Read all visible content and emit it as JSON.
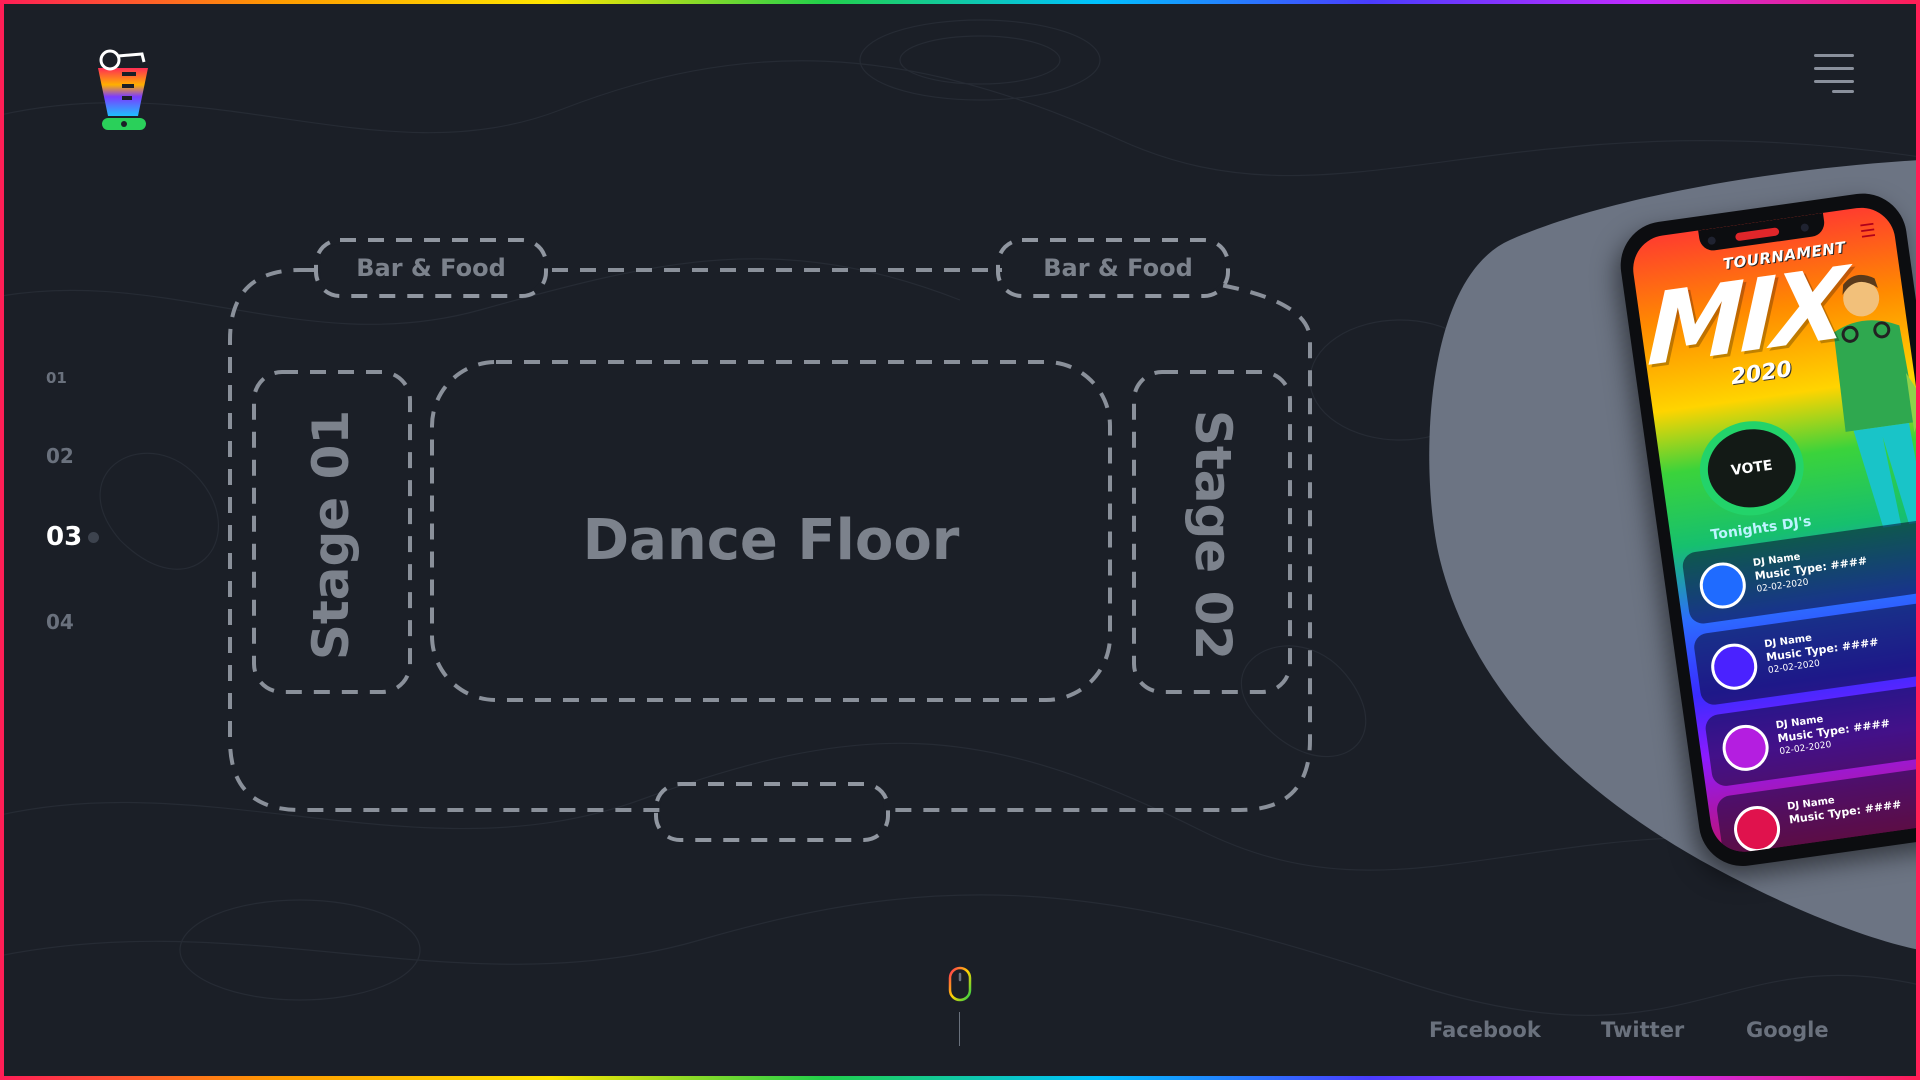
{
  "pager": {
    "items": [
      {
        "label": "01"
      },
      {
        "label": "02"
      },
      {
        "label": "03",
        "active": true
      },
      {
        "label": "04"
      }
    ]
  },
  "floorplan": {
    "bar_left": "Bar & Food",
    "bar_right": "Bar & Food",
    "stage_left": "Stage 01",
    "stage_right": "Stage 02",
    "center": "Dance Floor"
  },
  "phone": {
    "subtitle": "TOURNAMENT",
    "title": "MIX",
    "year": "2020",
    "vote_label": "VOTE",
    "list_heading": "Tonights DJ's",
    "djs": [
      {
        "name": "DJ Name",
        "type": "Music Type: ####",
        "date": "02-02-2020",
        "color": "#1f6bff"
      },
      {
        "name": "DJ Name",
        "type": "Music Type: ####",
        "date": "02-02-2020",
        "color": "#4a22ff"
      },
      {
        "name": "DJ Name",
        "type": "Music Type: ####",
        "date": "02-02-2020",
        "color": "#b41ee0"
      },
      {
        "name": "DJ Name",
        "type": "Music Type: ####",
        "date": "",
        "color": "#e0124d"
      }
    ]
  },
  "social": {
    "facebook": "Facebook",
    "twitter": "Twitter",
    "google": "Google"
  },
  "icons": {
    "logo": "dj-logo-icon",
    "menu": "hamburger-menu-icon",
    "scroll": "mouse-scroll-icon",
    "app_menu": "app-menu-icon"
  },
  "colors": {
    "background": "#1b1f27",
    "muted_text": "#6a717d",
    "blob": "#6c7483",
    "vote_ring": "#23d36a"
  }
}
